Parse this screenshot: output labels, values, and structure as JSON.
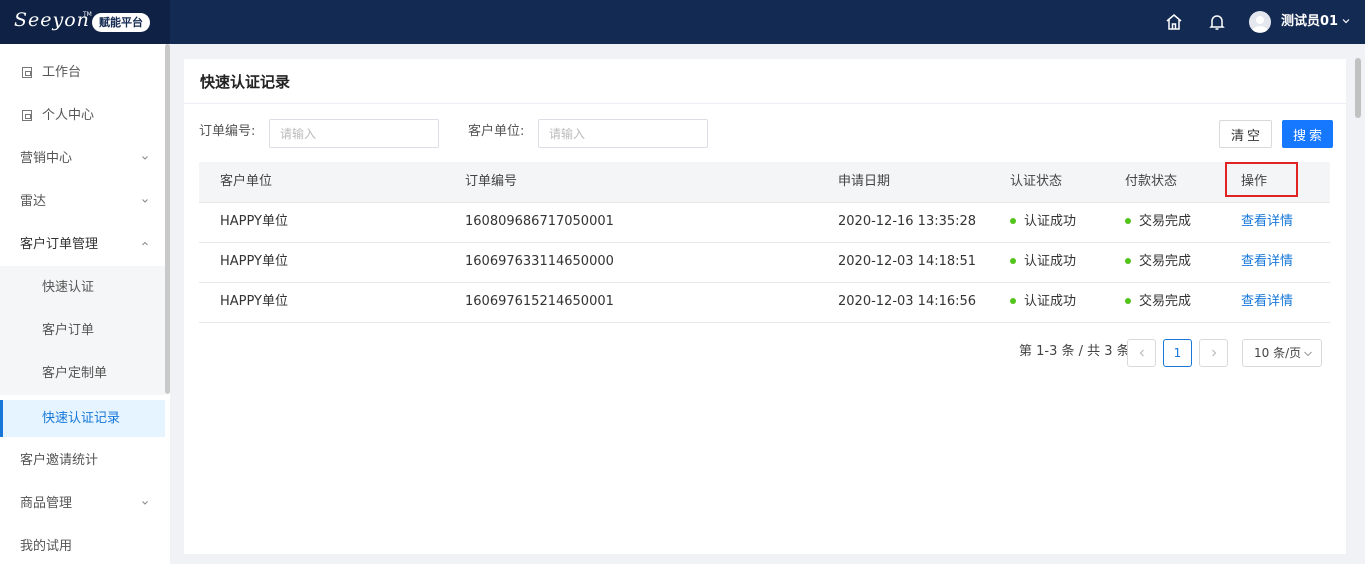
{
  "brand": {
    "logo_text": "Seeyon",
    "tm": "TM",
    "badge": "赋能平台"
  },
  "header": {
    "user_name": "测试员01"
  },
  "sidebar": {
    "items": [
      {
        "label": "工作台"
      },
      {
        "label": "个人中心"
      },
      {
        "label": "营销中心"
      },
      {
        "label": "雷达"
      },
      {
        "label": "客户订单管理"
      },
      {
        "label": "快速认证"
      },
      {
        "label": "客户订单"
      },
      {
        "label": "客户定制单"
      },
      {
        "label": "快速认证记录"
      },
      {
        "label": "客户邀请统计"
      },
      {
        "label": "商品管理"
      },
      {
        "label": "我的试用"
      }
    ]
  },
  "page": {
    "title": "快速认证记录"
  },
  "filters": {
    "order_no_label": "订单编号:",
    "order_no_placeholder": "请输入",
    "customer_label": "客户单位:",
    "customer_placeholder": "请输入",
    "clear_label": "清空",
    "search_label": "搜索"
  },
  "table": {
    "headers": [
      "客户单位",
      "订单编号",
      "申请日期",
      "认证状态",
      "付款状态",
      "操作"
    ],
    "rows": [
      {
        "customer": "HAPPY单位",
        "order_no": "160809686717050001",
        "date": "2020-12-16 13:35:28",
        "auth_status": "认证成功",
        "pay_status": "交易完成",
        "action": "查看详情"
      },
      {
        "customer": "HAPPY单位",
        "order_no": "160697633114650000",
        "date": "2020-12-03 14:18:51",
        "auth_status": "认证成功",
        "pay_status": "交易完成",
        "action": "查看详情"
      },
      {
        "customer": "HAPPY单位",
        "order_no": "160697615214650001",
        "date": "2020-12-03 14:16:56",
        "auth_status": "认证成功",
        "pay_status": "交易完成",
        "action": "查看详情"
      }
    ]
  },
  "pagination": {
    "summary": "第 1-3 条 / 共 3 条",
    "prev": "<",
    "current": "1",
    "next": ">",
    "page_size": "10 条/页"
  },
  "colors": {
    "header_bg": "#132a52",
    "accent": "#1677d9",
    "success_dot": "#52c41a",
    "highlight": "#e02424"
  }
}
